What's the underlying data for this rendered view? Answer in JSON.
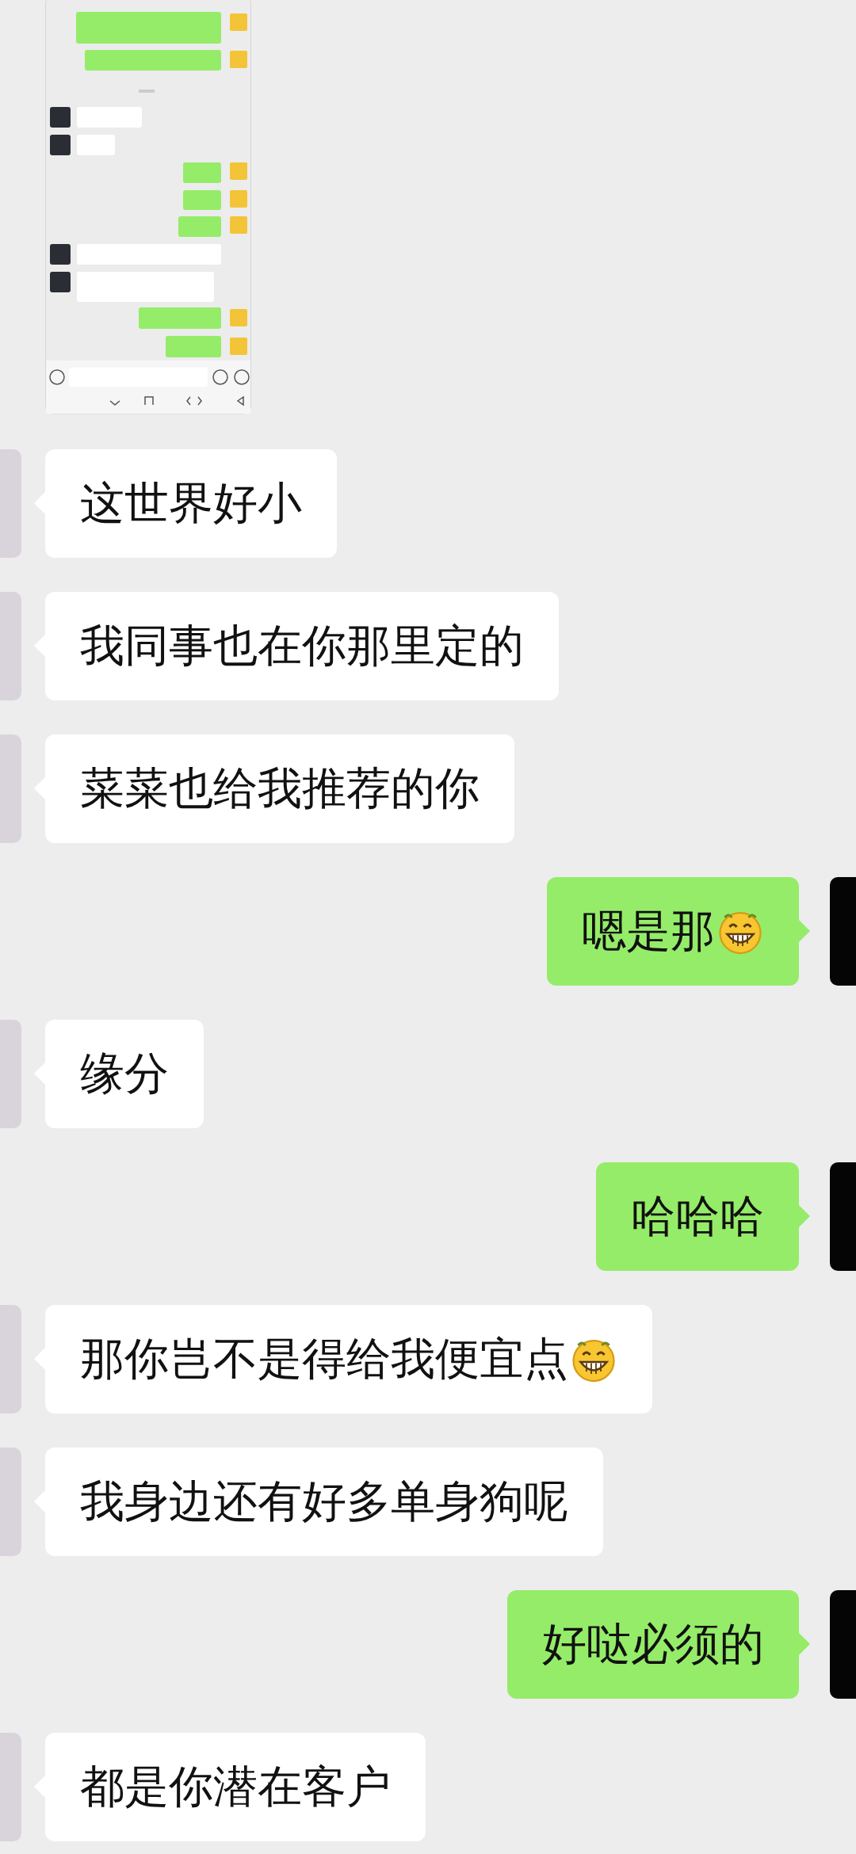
{
  "messages": [
    {
      "kind": "received",
      "text": "这世界好小",
      "emoji": false
    },
    {
      "kind": "received",
      "text": "我同事也在你那里定的",
      "emoji": false
    },
    {
      "kind": "received",
      "text": "菜菜也给我推荐的你",
      "emoji": false
    },
    {
      "kind": "sent",
      "text": "嗯是那",
      "emoji": true
    },
    {
      "kind": "received",
      "text": "缘分",
      "emoji": false
    },
    {
      "kind": "sent",
      "text": "哈哈哈",
      "emoji": false
    },
    {
      "kind": "received",
      "text": "那你岂不是得给我便宜点",
      "emoji": true
    },
    {
      "kind": "received",
      "text": "我身边还有好多单身狗呢",
      "emoji": false
    },
    {
      "kind": "sent",
      "text": "好哒必须的",
      "emoji": false
    },
    {
      "kind": "received",
      "text": "都是你潜在客户",
      "emoji": false
    }
  ]
}
